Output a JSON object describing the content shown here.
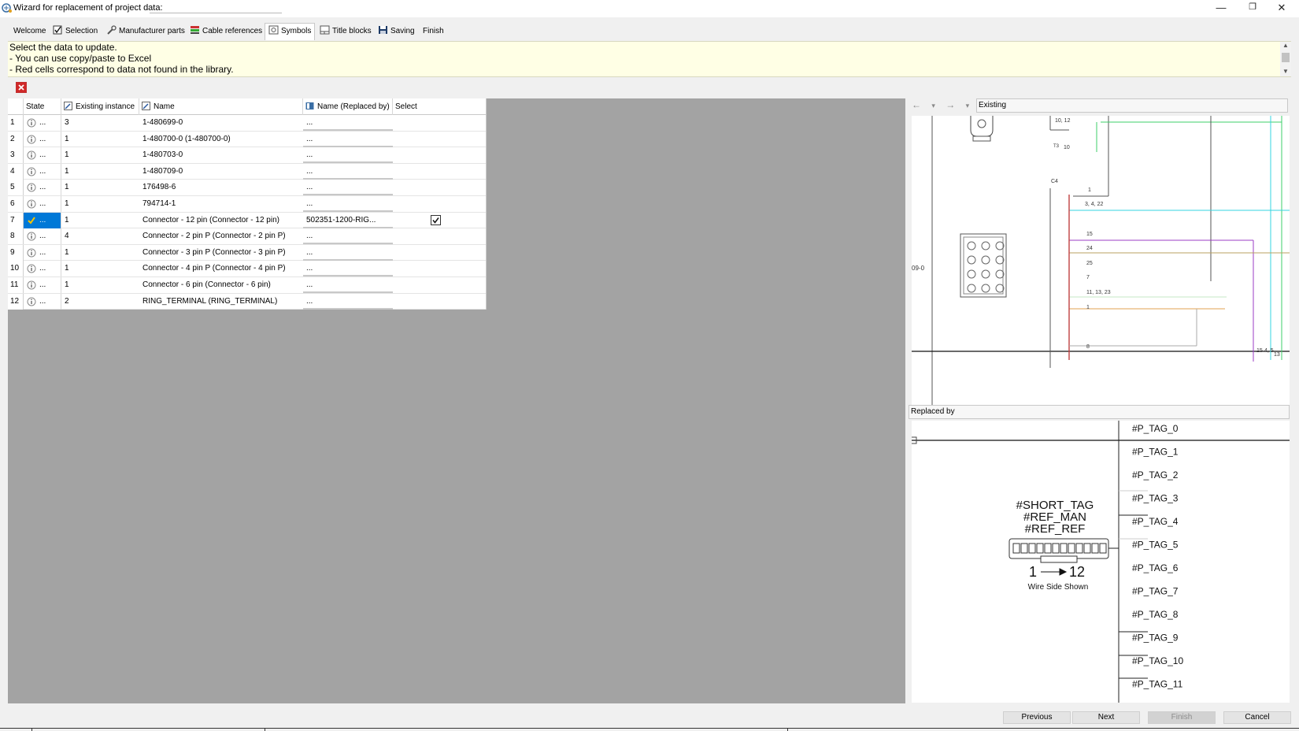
{
  "window": {
    "title": "Wizard for replacement of project data:",
    "controls": {
      "minimize": "—",
      "restore": "❐",
      "close": "✕"
    }
  },
  "tabs": [
    {
      "label": "Welcome",
      "icon": "none"
    },
    {
      "label": "Selection",
      "icon": "checkbox-icon"
    },
    {
      "label": "Manufacturer parts",
      "icon": "wrench-icon"
    },
    {
      "label": "Cable references",
      "icon": "cable-icon"
    },
    {
      "label": "Symbols",
      "icon": "symbol-icon",
      "active": true
    },
    {
      "label": "Title blocks",
      "icon": "title-block-icon"
    },
    {
      "label": "Saving",
      "icon": "save-icon"
    },
    {
      "label": "Finish",
      "icon": "none"
    }
  ],
  "info": {
    "lines": [
      "Select the data to update.",
      "- You can use copy/paste to Excel",
      "- Red cells correspond to data not found in the library."
    ]
  },
  "table": {
    "headers": {
      "state": "State",
      "existing_instance": "Existing instance",
      "name": "Name",
      "replaced_by": "Name (Replaced by)",
      "select": "Select"
    },
    "rows": [
      {
        "num": "1",
        "state_dots": "...",
        "instance": "3",
        "name": "1-480699-0",
        "replaced": "...",
        "selected": false,
        "status": "info"
      },
      {
        "num": "2",
        "state_dots": "...",
        "instance": "1",
        "name": "1-480700-0 (1-480700-0)",
        "replaced": "...",
        "selected": false,
        "status": "info"
      },
      {
        "num": "3",
        "state_dots": "...",
        "instance": "1",
        "name": "1-480703-0",
        "replaced": "...",
        "selected": false,
        "status": "info"
      },
      {
        "num": "4",
        "state_dots": "...",
        "instance": "1",
        "name": "1-480709-0",
        "replaced": "...",
        "selected": false,
        "status": "info"
      },
      {
        "num": "5",
        "state_dots": "...",
        "instance": "1",
        "name": "176498-6",
        "replaced": "...",
        "selected": false,
        "status": "info"
      },
      {
        "num": "6",
        "state_dots": "...",
        "instance": "1",
        "name": "794714-1",
        "replaced": "...",
        "selected": false,
        "status": "info"
      },
      {
        "num": "7",
        "state_dots": "...",
        "instance": "1",
        "name": "Connector - 12 pin (Connector - 12 pin)",
        "replaced": "502351-1200-RIG...",
        "selected": true,
        "status": "ok"
      },
      {
        "num": "8",
        "state_dots": "...",
        "instance": "4",
        "name": "Connector - 2 pin P (Connector - 2 pin P)",
        "replaced": "...",
        "selected": false,
        "status": "info"
      },
      {
        "num": "9",
        "state_dots": "...",
        "instance": "1",
        "name": "Connector - 3 pin P (Connector - 3 pin P)",
        "replaced": "...",
        "selected": false,
        "status": "info"
      },
      {
        "num": "10",
        "state_dots": "...",
        "instance": "1",
        "name": "Connector - 4 pin P (Connector - 4 pin P)",
        "replaced": "...",
        "selected": false,
        "status": "info"
      },
      {
        "num": "11",
        "state_dots": "...",
        "instance": "1",
        "name": "Connector - 6 pin (Connector - 6 pin)",
        "replaced": "...",
        "selected": false,
        "status": "info"
      },
      {
        "num": "12",
        "state_dots": "...",
        "instance": "2",
        "name": "RING_TERMINAL (RING_TERMINAL)",
        "replaced": "...",
        "selected": false,
        "status": "info"
      }
    ]
  },
  "preview": {
    "existing_label": "Existing",
    "replaced_label": "Replaced by",
    "nav": {
      "back": "←",
      "forward": "→",
      "dropdown": "▾"
    },
    "existing_texts": {
      "t1": "10, 12",
      "t2": "10",
      "t3": "C4",
      "t4": "1",
      "t5": "3, 4, 22",
      "t6": "15",
      "t7": "24",
      "t8": "25",
      "t9": "7",
      "t10": "11, 13, 23",
      "t11": "1",
      "t12": "8",
      "t13": "09-0",
      "t14": "15",
      "t15": "4, 5",
      "t16": "13",
      "t17": "T3"
    },
    "replaced_texts": {
      "short_tag": "#SHORT_TAG",
      "ref_man": "#REF_MAN",
      "ref_ref": "#REF_REF",
      "pin_start": "1",
      "pin_end": "12",
      "wire_side": "Wire Side Shown",
      "pin_tags": [
        "#P_TAG_0",
        "#P_TAG_1",
        "#P_TAG_2",
        "#P_TAG_3",
        "#P_TAG_4",
        "#P_TAG_5",
        "#P_TAG_6",
        "#P_TAG_7",
        "#P_TAG_8",
        "#P_TAG_9",
        "#P_TAG_10",
        "#P_TAG_11"
      ]
    }
  },
  "buttons": {
    "previous": "Previous",
    "next": "Next",
    "finish": "Finish",
    "cancel": "Cancel"
  },
  "colors": {
    "selection": "#0078d7",
    "info_background": "#ffffe5",
    "grid_background": "#a3a3a3",
    "wire_green": "#3ecf6a",
    "wire_cyan": "#33d6e0",
    "wire_purple": "#9b3cc4",
    "wire_red": "#d22"
  }
}
